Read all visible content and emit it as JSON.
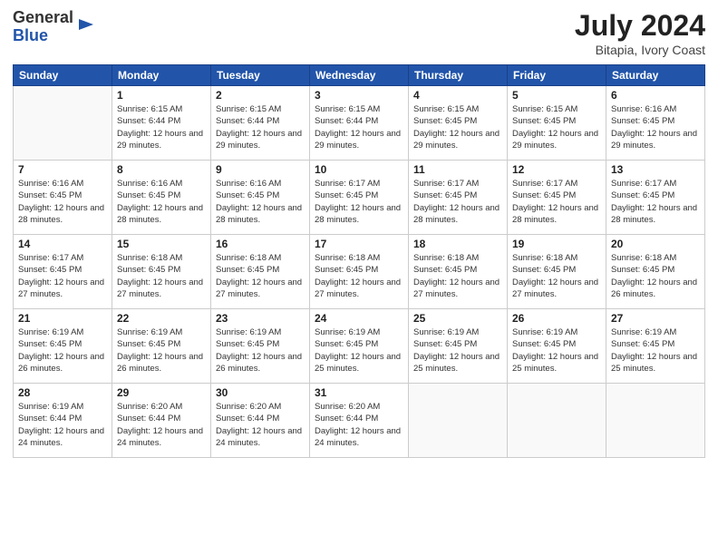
{
  "header": {
    "logo_general": "General",
    "logo_blue": "Blue",
    "month_year": "July 2024",
    "location": "Bitapia, Ivory Coast"
  },
  "weekdays": [
    "Sunday",
    "Monday",
    "Tuesday",
    "Wednesday",
    "Thursday",
    "Friday",
    "Saturday"
  ],
  "weeks": [
    [
      {
        "day": "",
        "sunrise": "",
        "sunset": "",
        "daylight": ""
      },
      {
        "day": "1",
        "sunrise": "Sunrise: 6:15 AM",
        "sunset": "Sunset: 6:44 PM",
        "daylight": "Daylight: 12 hours and 29 minutes."
      },
      {
        "day": "2",
        "sunrise": "Sunrise: 6:15 AM",
        "sunset": "Sunset: 6:44 PM",
        "daylight": "Daylight: 12 hours and 29 minutes."
      },
      {
        "day": "3",
        "sunrise": "Sunrise: 6:15 AM",
        "sunset": "Sunset: 6:44 PM",
        "daylight": "Daylight: 12 hours and 29 minutes."
      },
      {
        "day": "4",
        "sunrise": "Sunrise: 6:15 AM",
        "sunset": "Sunset: 6:45 PM",
        "daylight": "Daylight: 12 hours and 29 minutes."
      },
      {
        "day": "5",
        "sunrise": "Sunrise: 6:15 AM",
        "sunset": "Sunset: 6:45 PM",
        "daylight": "Daylight: 12 hours and 29 minutes."
      },
      {
        "day": "6",
        "sunrise": "Sunrise: 6:16 AM",
        "sunset": "Sunset: 6:45 PM",
        "daylight": "Daylight: 12 hours and 29 minutes."
      }
    ],
    [
      {
        "day": "7",
        "sunrise": "Sunrise: 6:16 AM",
        "sunset": "Sunset: 6:45 PM",
        "daylight": "Daylight: 12 hours and 28 minutes."
      },
      {
        "day": "8",
        "sunrise": "Sunrise: 6:16 AM",
        "sunset": "Sunset: 6:45 PM",
        "daylight": "Daylight: 12 hours and 28 minutes."
      },
      {
        "day": "9",
        "sunrise": "Sunrise: 6:16 AM",
        "sunset": "Sunset: 6:45 PM",
        "daylight": "Daylight: 12 hours and 28 minutes."
      },
      {
        "day": "10",
        "sunrise": "Sunrise: 6:17 AM",
        "sunset": "Sunset: 6:45 PM",
        "daylight": "Daylight: 12 hours and 28 minutes."
      },
      {
        "day": "11",
        "sunrise": "Sunrise: 6:17 AM",
        "sunset": "Sunset: 6:45 PM",
        "daylight": "Daylight: 12 hours and 28 minutes."
      },
      {
        "day": "12",
        "sunrise": "Sunrise: 6:17 AM",
        "sunset": "Sunset: 6:45 PM",
        "daylight": "Daylight: 12 hours and 28 minutes."
      },
      {
        "day": "13",
        "sunrise": "Sunrise: 6:17 AM",
        "sunset": "Sunset: 6:45 PM",
        "daylight": "Daylight: 12 hours and 28 minutes."
      }
    ],
    [
      {
        "day": "14",
        "sunrise": "Sunrise: 6:17 AM",
        "sunset": "Sunset: 6:45 PM",
        "daylight": "Daylight: 12 hours and 27 minutes."
      },
      {
        "day": "15",
        "sunrise": "Sunrise: 6:18 AM",
        "sunset": "Sunset: 6:45 PM",
        "daylight": "Daylight: 12 hours and 27 minutes."
      },
      {
        "day": "16",
        "sunrise": "Sunrise: 6:18 AM",
        "sunset": "Sunset: 6:45 PM",
        "daylight": "Daylight: 12 hours and 27 minutes."
      },
      {
        "day": "17",
        "sunrise": "Sunrise: 6:18 AM",
        "sunset": "Sunset: 6:45 PM",
        "daylight": "Daylight: 12 hours and 27 minutes."
      },
      {
        "day": "18",
        "sunrise": "Sunrise: 6:18 AM",
        "sunset": "Sunset: 6:45 PM",
        "daylight": "Daylight: 12 hours and 27 minutes."
      },
      {
        "day": "19",
        "sunrise": "Sunrise: 6:18 AM",
        "sunset": "Sunset: 6:45 PM",
        "daylight": "Daylight: 12 hours and 27 minutes."
      },
      {
        "day": "20",
        "sunrise": "Sunrise: 6:18 AM",
        "sunset": "Sunset: 6:45 PM",
        "daylight": "Daylight: 12 hours and 26 minutes."
      }
    ],
    [
      {
        "day": "21",
        "sunrise": "Sunrise: 6:19 AM",
        "sunset": "Sunset: 6:45 PM",
        "daylight": "Daylight: 12 hours and 26 minutes."
      },
      {
        "day": "22",
        "sunrise": "Sunrise: 6:19 AM",
        "sunset": "Sunset: 6:45 PM",
        "daylight": "Daylight: 12 hours and 26 minutes."
      },
      {
        "day": "23",
        "sunrise": "Sunrise: 6:19 AM",
        "sunset": "Sunset: 6:45 PM",
        "daylight": "Daylight: 12 hours and 26 minutes."
      },
      {
        "day": "24",
        "sunrise": "Sunrise: 6:19 AM",
        "sunset": "Sunset: 6:45 PM",
        "daylight": "Daylight: 12 hours and 25 minutes."
      },
      {
        "day": "25",
        "sunrise": "Sunrise: 6:19 AM",
        "sunset": "Sunset: 6:45 PM",
        "daylight": "Daylight: 12 hours and 25 minutes."
      },
      {
        "day": "26",
        "sunrise": "Sunrise: 6:19 AM",
        "sunset": "Sunset: 6:45 PM",
        "daylight": "Daylight: 12 hours and 25 minutes."
      },
      {
        "day": "27",
        "sunrise": "Sunrise: 6:19 AM",
        "sunset": "Sunset: 6:45 PM",
        "daylight": "Daylight: 12 hours and 25 minutes."
      }
    ],
    [
      {
        "day": "28",
        "sunrise": "Sunrise: 6:19 AM",
        "sunset": "Sunset: 6:44 PM",
        "daylight": "Daylight: 12 hours and 24 minutes."
      },
      {
        "day": "29",
        "sunrise": "Sunrise: 6:20 AM",
        "sunset": "Sunset: 6:44 PM",
        "daylight": "Daylight: 12 hours and 24 minutes."
      },
      {
        "day": "30",
        "sunrise": "Sunrise: 6:20 AM",
        "sunset": "Sunset: 6:44 PM",
        "daylight": "Daylight: 12 hours and 24 minutes."
      },
      {
        "day": "31",
        "sunrise": "Sunrise: 6:20 AM",
        "sunset": "Sunset: 6:44 PM",
        "daylight": "Daylight: 12 hours and 24 minutes."
      },
      {
        "day": "",
        "sunrise": "",
        "sunset": "",
        "daylight": ""
      },
      {
        "day": "",
        "sunrise": "",
        "sunset": "",
        "daylight": ""
      },
      {
        "day": "",
        "sunrise": "",
        "sunset": "",
        "daylight": ""
      }
    ]
  ]
}
